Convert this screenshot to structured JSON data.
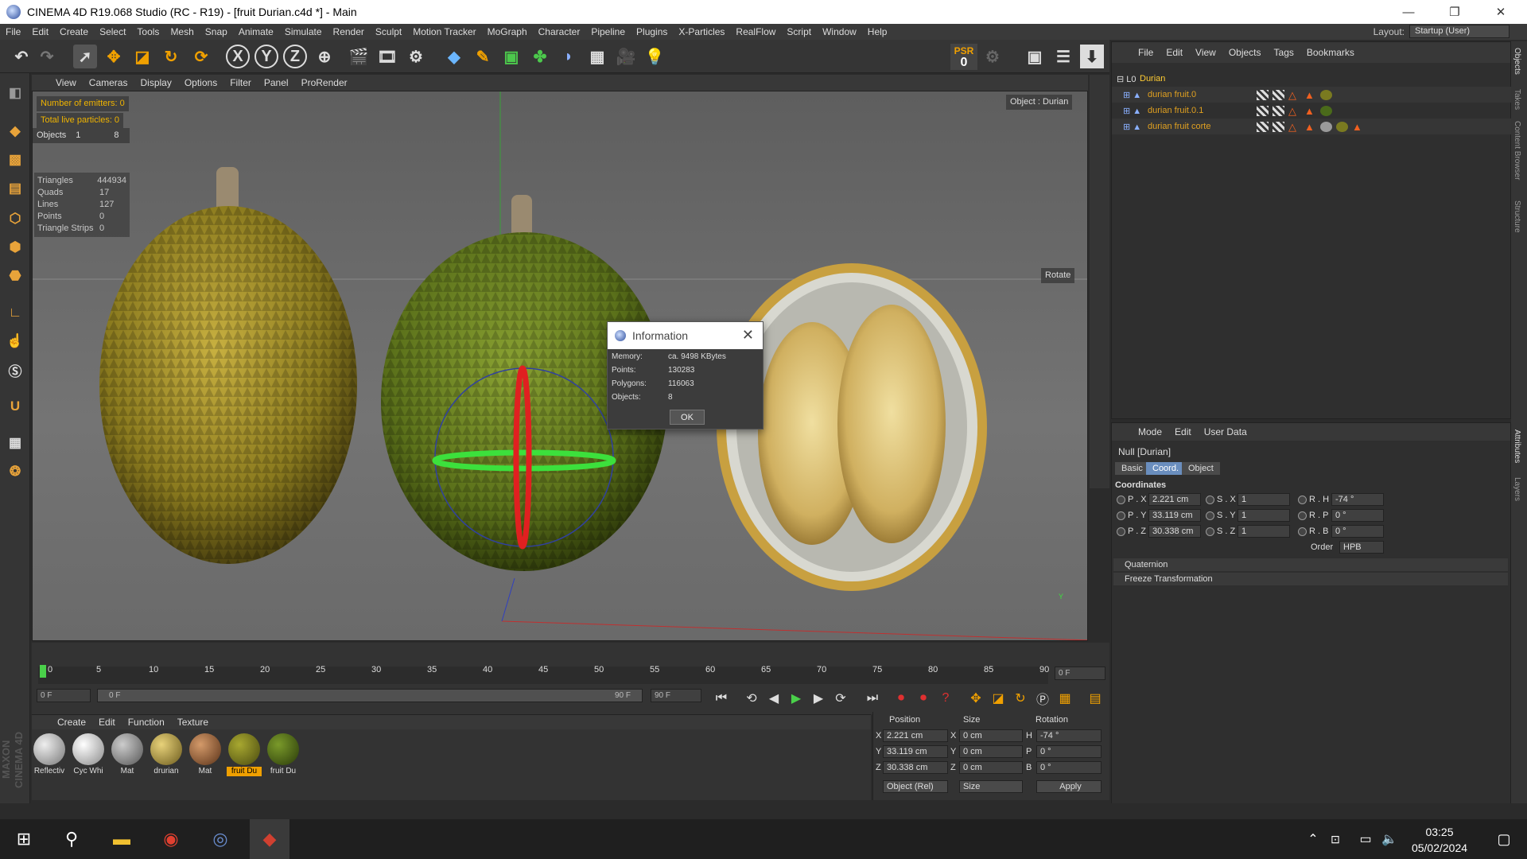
{
  "window": {
    "title": "CINEMA 4D R19.068 Studio (RC - R19) - [fruit Durian.c4d *] - Main",
    "min": "—",
    "max": "❐",
    "close": "✕"
  },
  "menubar": {
    "items": [
      "File",
      "Edit",
      "Create",
      "Select",
      "Tools",
      "Mesh",
      "Snap",
      "Animate",
      "Simulate",
      "Render",
      "Sculpt",
      "Motion Tracker",
      "MoGraph",
      "Character",
      "Pipeline",
      "Plugins",
      "X-Particles",
      "RealFlow",
      "Script",
      "Window",
      "Help"
    ],
    "layout_label": "Layout:",
    "layout_value": "Startup (User)"
  },
  "toolbar": {
    "axis": [
      "X",
      "Y",
      "Z"
    ],
    "psr_label": "PSR",
    "psr_value": "0"
  },
  "viewport": {
    "menu": [
      "View",
      "Cameras",
      "Display",
      "Options",
      "Filter",
      "Panel",
      "ProRender"
    ],
    "emitters": "Number of emitters: 0",
    "particles": "Total live particles: 0",
    "objects_label": "Objects",
    "objects_a": "1",
    "objects_b": "8",
    "object_hud": "Object : Durian",
    "rotate": "Rotate",
    "stats": [
      {
        "k": "Triangles",
        "v": "444934"
      },
      {
        "k": "Quads",
        "v": "17"
      },
      {
        "k": "Lines",
        "v": "127"
      },
      {
        "k": "Points",
        "v": "0"
      },
      {
        "k": "Triangle Strips",
        "v": "0"
      }
    ],
    "axis_y": "Y"
  },
  "dialog": {
    "title": "Information",
    "close": "✕",
    "rows": [
      {
        "k": "Memory:",
        "v": "ca. 9498 KBytes"
      },
      {
        "k": "Points:",
        "v": "130283"
      },
      {
        "k": "Polygons:",
        "v": "116063"
      },
      {
        "k": "Objects:",
        "v": "8"
      }
    ],
    "ok": "OK"
  },
  "objects": {
    "menu": [
      "File",
      "Edit",
      "View",
      "Objects",
      "Tags",
      "Bookmarks"
    ],
    "rows": [
      {
        "name": "Durian",
        "color": "#ffcc33"
      },
      {
        "name": "durian fruit.0",
        "color": "#e0a020"
      },
      {
        "name": "durian fruit.0.1",
        "color": "#e0a020"
      },
      {
        "name": "durian fruit corte",
        "color": "#e0a020"
      }
    ]
  },
  "attributes": {
    "menu": [
      "Mode",
      "Edit",
      "User Data"
    ],
    "object_name": "Null [Durian]",
    "tabs": [
      "Basic",
      "Coord.",
      "Object"
    ],
    "section": "Coordinates",
    "pos": [
      {
        "l": "P . X",
        "v": "2.221 cm"
      },
      {
        "l": "P . Y",
        "v": "33.119 cm"
      },
      {
        "l": "P . Z",
        "v": "30.338 cm"
      }
    ],
    "scale": [
      {
        "l": "S . X",
        "v": "1"
      },
      {
        "l": "S . Y",
        "v": "1"
      },
      {
        "l": "S . Z",
        "v": "1"
      }
    ],
    "rot": [
      {
        "l": "R . H",
        "v": "-74 °"
      },
      {
        "l": "R . P",
        "v": "0 °"
      },
      {
        "l": "R . B",
        "v": "0 °"
      }
    ],
    "order_label": "Order",
    "order_value": "HPB",
    "collapsed": [
      "Quaternion",
      "Freeze Transformation"
    ]
  },
  "timeline": {
    "ticks": [
      "0",
      "5",
      "10",
      "15",
      "20",
      "25",
      "30",
      "35",
      "40",
      "45",
      "50",
      "55",
      "60",
      "65",
      "70",
      "75",
      "80",
      "85",
      "90"
    ],
    "frame_end": "0 F",
    "start": "0 F",
    "range_start": "0 F",
    "range_end": "90 F",
    "end": "90 F"
  },
  "materials": {
    "menu": [
      "Create",
      "Edit",
      "Function",
      "Texture"
    ],
    "items": [
      {
        "name": "Reflectiv",
        "c1": "#eeeeee",
        "c2": "#777777",
        "hl": false
      },
      {
        "name": "Cyc Whi",
        "c1": "#ffffff",
        "c2": "#888888",
        "hl": false
      },
      {
        "name": "Mat",
        "c1": "#cccccc",
        "c2": "#555555",
        "hl": false
      },
      {
        "name": "drurian",
        "c1": "#e8d27a",
        "c2": "#6b5a1c",
        "hl": false
      },
      {
        "name": "Mat",
        "c1": "#d49a6a",
        "c2": "#5a3218",
        "hl": false
      },
      {
        "name": "fruit Du",
        "c1": "#a8a830",
        "c2": "#4a4a10",
        "hl": true
      },
      {
        "name": "fruit Du",
        "c1": "#7a9a2a",
        "c2": "#2a3a0a",
        "hl": false
      }
    ]
  },
  "coords": {
    "headers": [
      "Position",
      "Size",
      "Rotation"
    ],
    "rows": [
      {
        "pl": "X",
        "pv": "2.221 cm",
        "sl": "X",
        "sv": "0 cm",
        "rl": "H",
        "rv": "-74 °"
      },
      {
        "pl": "Y",
        "pv": "33.119 cm",
        "sl": "Y",
        "sv": "0 cm",
        "rl": "P",
        "rv": "0 °"
      },
      {
        "pl": "Z",
        "pv": "30.338 cm",
        "sl": "Z",
        "sv": "0 cm",
        "rl": "B",
        "rv": "0 °"
      }
    ],
    "mode": "Object (Rel)",
    "size_mode": "Size",
    "apply": "Apply"
  },
  "taskbar": {
    "time": "03:25",
    "date": "05/02/2024"
  },
  "side_tabs": [
    "Objects",
    "Takes",
    "Content Browser",
    "Structure",
    "Attributes",
    "Layers"
  ],
  "maxon": "MAXON CINEMA 4D"
}
